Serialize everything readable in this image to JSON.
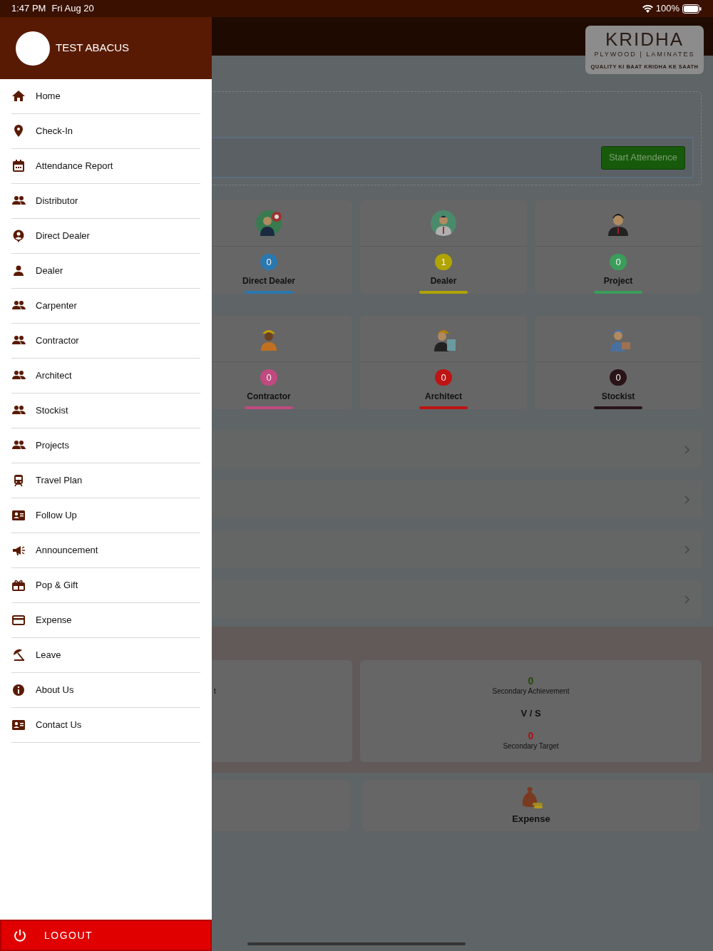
{
  "status_bar": {
    "time": "1:47 PM",
    "date": "Fri Aug 20",
    "battery": "100%"
  },
  "drawer": {
    "user_name": "TEST ABACUS",
    "items": [
      {
        "label": "Home"
      },
      {
        "label": "Check-In"
      },
      {
        "label": "Attendance Report"
      },
      {
        "label": "Distributor"
      },
      {
        "label": "Direct Dealer"
      },
      {
        "label": "Dealer"
      },
      {
        "label": "Carpenter"
      },
      {
        "label": "Contractor"
      },
      {
        "label": "Architect"
      },
      {
        "label": "Stockist"
      },
      {
        "label": "Projects"
      },
      {
        "label": "Travel Plan"
      },
      {
        "label": "Follow Up"
      },
      {
        "label": "Announcement"
      },
      {
        "label": "Pop & Gift"
      },
      {
        "label": "Expense"
      },
      {
        "label": "Leave"
      },
      {
        "label": "About Us"
      },
      {
        "label": "Contact Us"
      }
    ],
    "logout": "LOGOUT"
  },
  "logo": {
    "name": "KRIDHA",
    "subtitle": "PLYWOOD | LAMINATES",
    "tagline": "QUALITY KI BAAT KRIDHA KE SAATH"
  },
  "attendance_button": "Start Attendence",
  "tiles": [
    {
      "label": "Direct Dealer",
      "count": "0",
      "color": "#2a78b0"
    },
    {
      "label": "Dealer",
      "count": "1",
      "color": "#b0a400"
    },
    {
      "label": "Project",
      "count": "0",
      "color": "#3a9e5a"
    },
    {
      "label": "Contractor",
      "count": "0",
      "color": "#c04a80"
    },
    {
      "label": "Architect",
      "count": "0",
      "color": "#be1414"
    },
    {
      "label": "Stockist",
      "count": "0",
      "color": "#2a1418"
    }
  ],
  "targets": {
    "cut_text": "t",
    "achievement": "0",
    "achievement_label": "Secondary Achievement",
    "vs": "V / S",
    "target": "0",
    "target_label": "Secondary Target"
  },
  "expense_label": "Expense"
}
